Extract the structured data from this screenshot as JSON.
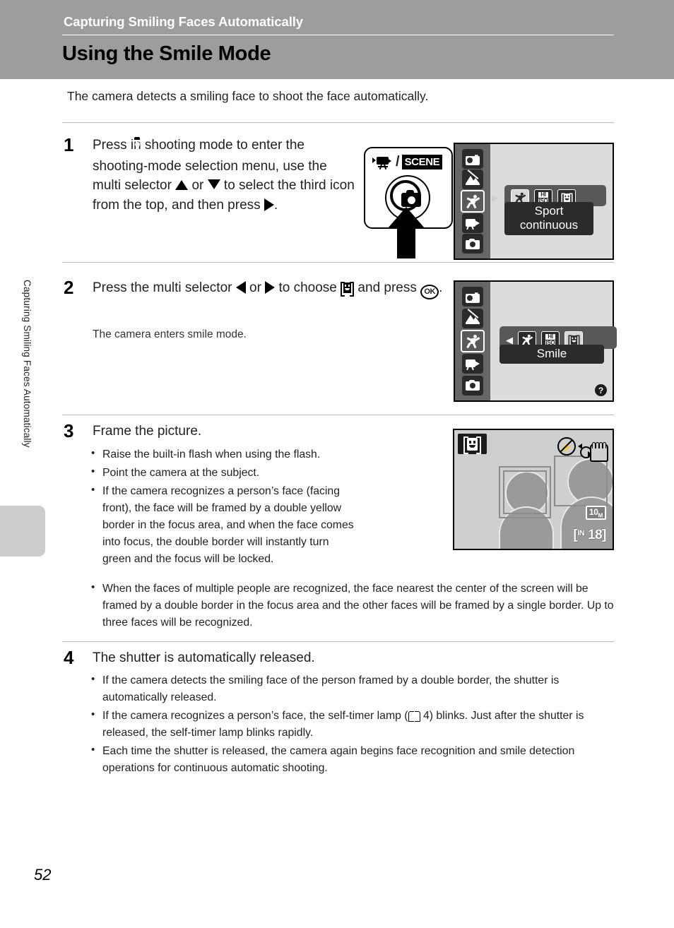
{
  "header": {
    "chapter": "Capturing Smiling Faces Automatically",
    "title": "Using the Smile Mode"
  },
  "side_tab": {
    "vertical_label": "Capturing Smiling Faces Automatically"
  },
  "intro": "The camera detects a smiling face to shoot the face automatically.",
  "steps": [
    {
      "number": "1",
      "text_parts": {
        "p1": "Press ",
        "icon1": "camera-icon",
        "p2": " in shooting mode to enter the shooting-mode selection menu, use the multi selector ",
        "icon2": "triangle-up-icon",
        "p3": " or ",
        "icon3": "triangle-down-icon",
        "p4": " to select the third icon from the top, and then press ",
        "icon4": "triangle-right-icon",
        "p5": "."
      }
    },
    {
      "number": "2",
      "text_parts": {
        "p1": "Press the multi selector ",
        "icon1": "triangle-left-icon",
        "p2": " or ",
        "icon2": "triangle-right-icon",
        "p3": " to choose ",
        "icon3": "smile-mode-icon",
        "p4": " and press ",
        "icon4": "ok-button-icon",
        "p5": "."
      },
      "note": "The camera enters smile mode."
    },
    {
      "number": "3",
      "heading": "Frame the picture.",
      "bullets": [
        "Raise the built-in flash when using the flash.",
        "Point the camera at the subject.",
        "If the camera recognizes a person’s face (facing front), the face will be framed by a double yellow border in the focus area, and when the face comes into focus, the double border will instantly turn green and the focus will be locked."
      ],
      "wide_bullets": [
        "When the faces of multiple people are recognized, the face nearest the center of the screen will be framed by a double border in the focus area and the other faces will be framed by a single border. Up to three faces will be recognized."
      ]
    },
    {
      "number": "4",
      "heading": "The shutter is automatically released.",
      "bullets": [
        "If the camera detects the smiling face of the person framed by a double border, the shutter is automatically released.",
        "Each time the shutter is released, the camera again begins face recognition and smile detection operations for continuous automatic shooting."
      ],
      "bullet_with_ref": {
        "pre": "If the camera recognizes a person’s face, the self-timer lamp (",
        "ref_icon": "book-icon",
        "ref_page": " 4",
        "post": ") blinks. Just after the shutter is released, the self-timer lamp blinks rapidly."
      }
    }
  ],
  "figure_button": {
    "movie_label": "movie-mode-icon",
    "separator": "/",
    "scene_label": "SCENE",
    "shutter_icon": "shooting-mode-button-icon",
    "arrow": "press-arrow-up-icon"
  },
  "figure_lcd_step1": {
    "mode_icons": [
      "portrait-assist-icon",
      "scene-mode-icon",
      "sport-continuous-icon",
      "movie-mode-icon",
      "auto-mode-icon"
    ],
    "selected_index": 2,
    "options": [
      "sport-continuous-icon",
      "high-iso-icon",
      "smile-mode-icon"
    ],
    "active_option_index": 0,
    "label": "Sport continuous"
  },
  "figure_lcd_step2": {
    "mode_icons": [
      "portrait-assist-icon",
      "scene-mode-icon",
      "sport-continuous-icon",
      "movie-mode-icon",
      "auto-mode-icon"
    ],
    "selected_index": 2,
    "options": [
      "sport-continuous-icon",
      "high-iso-icon",
      "smile-mode-icon"
    ],
    "active_option_index": 2,
    "label": "Smile",
    "left_caret": "◀",
    "help_badge": "?"
  },
  "figure_lcd_step3": {
    "mode_badge": "smile-mode-icon",
    "flash_indicator": "flash-off-icon",
    "shake_indicator": "camera-shake-warning-icon",
    "image_size": "10",
    "image_size_unit": "M",
    "memory_label": "IN",
    "shots_remaining": "18"
  },
  "page_number": "52",
  "colors": {
    "header_band": "#9d9d9d",
    "side_tab": "#cdcdcd",
    "lcd_background": "#dcdcdc",
    "lcd_sidebar": "#666666",
    "label_bar": "#2b2b2b"
  }
}
